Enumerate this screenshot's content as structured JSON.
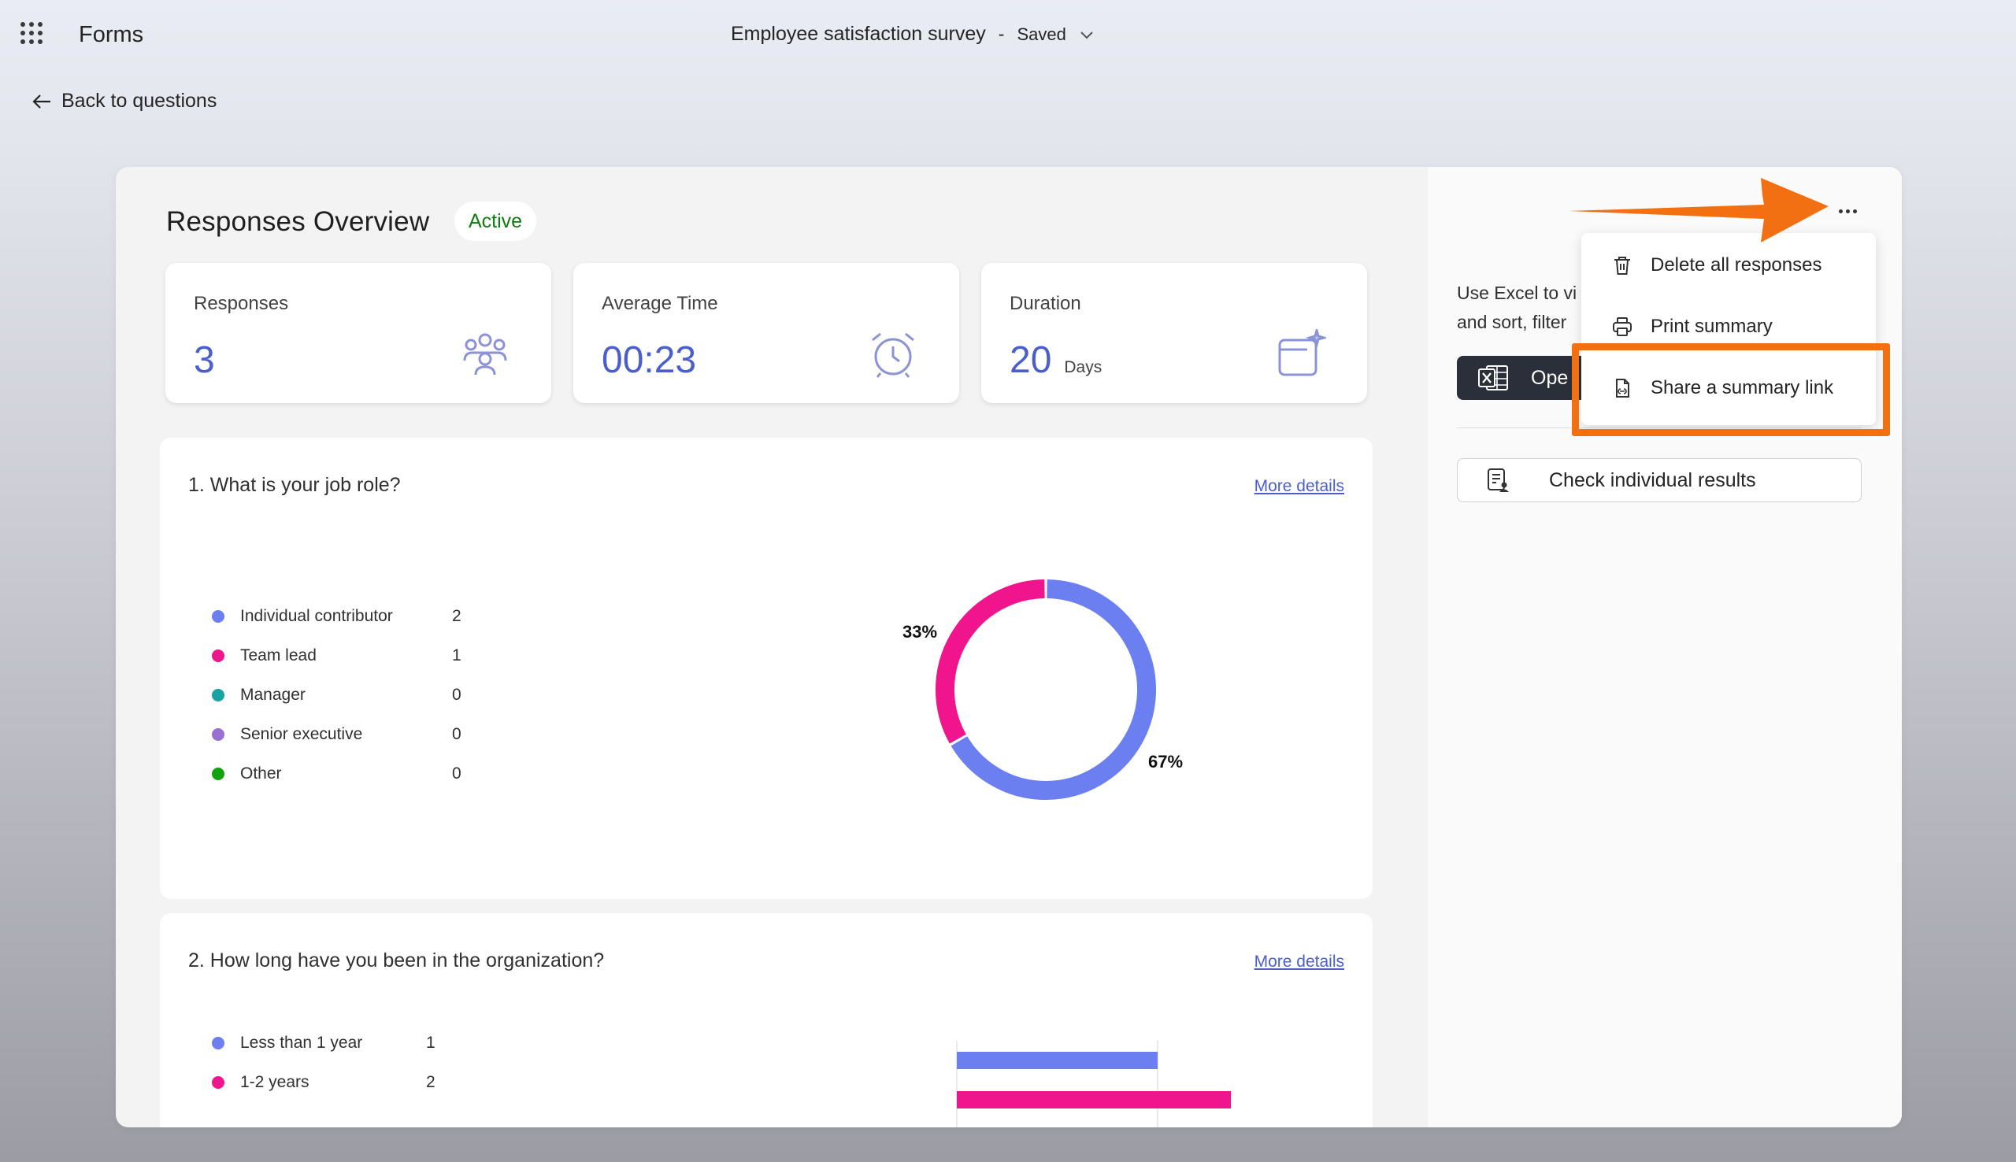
{
  "app": {
    "name": "Forms",
    "doc_title": "Employee satisfaction survey",
    "separator": "-",
    "save_status": "Saved",
    "back_label": "Back to questions"
  },
  "overview": {
    "title": "Responses Overview",
    "status": "Active",
    "stats": [
      {
        "label": "Responses",
        "value": "3",
        "unit": "",
        "icon": "people-icon"
      },
      {
        "label": "Average Time",
        "value": "00:23",
        "unit": "",
        "icon": "alarm-clock-icon"
      },
      {
        "label": "Duration",
        "value": "20",
        "unit": "Days",
        "icon": "calendar-sparkle-icon"
      }
    ]
  },
  "questions": [
    {
      "title": "1. What is your job role?",
      "more_label": "More details",
      "options": [
        {
          "label": "Individual contributor",
          "count": "2",
          "color": "#6b7ff0"
        },
        {
          "label": "Team lead",
          "count": "1",
          "color": "#f0158c"
        },
        {
          "label": "Manager",
          "count": "0",
          "color": "#1aa3a3"
        },
        {
          "label": "Senior executive",
          "count": "0",
          "color": "#9a6fd2"
        },
        {
          "label": "Other",
          "count": "0",
          "color": "#13a10e"
        }
      ],
      "donut_labels": {
        "left": "33%",
        "right": "67%"
      }
    },
    {
      "title": "2. How long have you been in the organization?",
      "more_label": "More details",
      "options": [
        {
          "label": "Less than 1 year",
          "count": "1",
          "color": "#6b7ff0"
        },
        {
          "label": "1-2 years",
          "count": "2",
          "color": "#f0158c"
        }
      ]
    }
  ],
  "chart_data": [
    {
      "type": "pie",
      "categories": [
        "Individual contributor",
        "Team lead",
        "Manager",
        "Senior executive",
        "Other"
      ],
      "values": [
        2,
        1,
        0,
        0,
        0
      ],
      "labels": [
        "67%",
        "33%"
      ]
    },
    {
      "type": "bar",
      "orientation": "horizontal",
      "categories": [
        "Less than 1 year",
        "1-2 years"
      ],
      "values": [
        1,
        2
      ],
      "xlim": [
        0,
        2
      ]
    }
  ],
  "right_panel": {
    "excel_text_line1": "Use Excel to vi",
    "excel_text_line2": "and sort, filter",
    "open_excel_label": "Ope",
    "check_results_label": "Check individual results"
  },
  "menu": {
    "items": [
      {
        "label": "Delete all responses",
        "icon": "trash-icon"
      },
      {
        "label": "Print summary",
        "icon": "printer-icon"
      },
      {
        "label": "Share a summary link",
        "icon": "document-link-icon"
      }
    ]
  },
  "colors": {
    "accent": "#4a5ecc",
    "active_green": "#107c10",
    "annotation_orange": "#f27012"
  }
}
